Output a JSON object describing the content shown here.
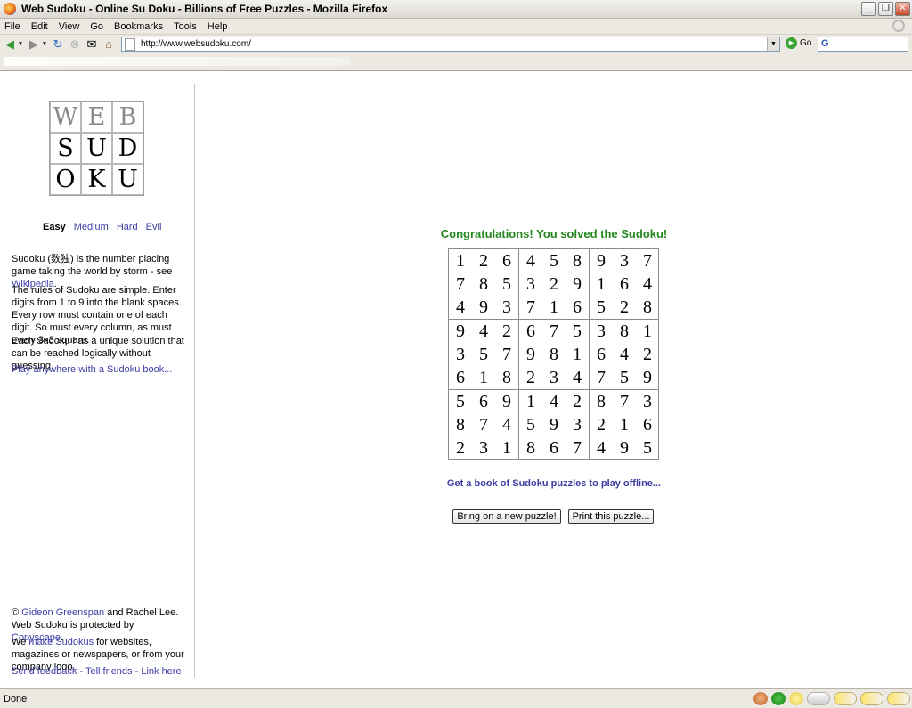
{
  "window": {
    "title": "Web Sudoku - Online Su Doku - Billions of Free Puzzles - Mozilla Firefox",
    "minimize_glyph": "_",
    "restore_glyph": "❐",
    "close_glyph": "✕"
  },
  "menu": [
    "File",
    "Edit",
    "View",
    "Go",
    "Bookmarks",
    "Tools",
    "Help"
  ],
  "toolbar": {
    "url": "http://www.websudoku.com/",
    "go_label": "Go",
    "search_glyph": "G"
  },
  "sidebar": {
    "logo": [
      "W",
      "E",
      "B",
      "S",
      "U",
      "D",
      "O",
      "K",
      "U"
    ],
    "levels": {
      "current": "Easy",
      "links": [
        "Medium",
        "Hard",
        "Evil"
      ]
    },
    "intro": {
      "text": "Sudoku (数独) is the number placing game taking the world by storm - see ",
      "link": "Wikipedia",
      "end": "."
    },
    "rules": "The rules of Sudoku are simple. Enter digits from 1 to 9 into the blank spaces. Every row must contain one of each digit. So must every column, as must every 3x3 square.",
    "unique": "Each Sudoku has a unique solution that can be reached logically without guessing.",
    "play_link": "Play anywhere with a Sudoku book...",
    "footer": {
      "copyright_symbol": "©",
      "author_link": "Gideon Greenspan",
      "author_rest": " and Rachel Lee.",
      "protected_text": "Web Sudoku is protected by ",
      "copyscape_link": "Copyscape",
      "period": ".",
      "we_text": "We ",
      "make_link": "make Sudokus",
      "make_rest": " for websites, magazines or newspapers, or from your company logo.",
      "feedback_link": "Send feedback",
      "tell_link": "Tell friends",
      "linkhere_link": "Link here",
      "separator": " - "
    }
  },
  "main": {
    "congrats": "Congratulations! You solved the Sudoku!",
    "grid": [
      [
        1,
        2,
        6,
        4,
        5,
        8,
        9,
        3,
        7
      ],
      [
        7,
        8,
        5,
        3,
        2,
        9,
        1,
        6,
        4
      ],
      [
        4,
        9,
        3,
        7,
        1,
        6,
        5,
        2,
        8
      ],
      [
        9,
        4,
        2,
        6,
        7,
        5,
        3,
        8,
        1
      ],
      [
        3,
        5,
        7,
        9,
        8,
        1,
        6,
        4,
        2
      ],
      [
        6,
        1,
        8,
        2,
        3,
        4,
        7,
        5,
        9
      ],
      [
        5,
        6,
        9,
        1,
        4,
        2,
        8,
        7,
        3
      ],
      [
        8,
        7,
        4,
        5,
        9,
        3,
        2,
        1,
        6
      ],
      [
        2,
        3,
        1,
        8,
        6,
        7,
        4,
        9,
        5
      ]
    ],
    "book_link": "Get a book of Sudoku puzzles to play offline...",
    "new_puzzle_button": "Bring on a new puzzle!",
    "print_button": "Print this puzzle..."
  },
  "status": {
    "text": "Done"
  }
}
